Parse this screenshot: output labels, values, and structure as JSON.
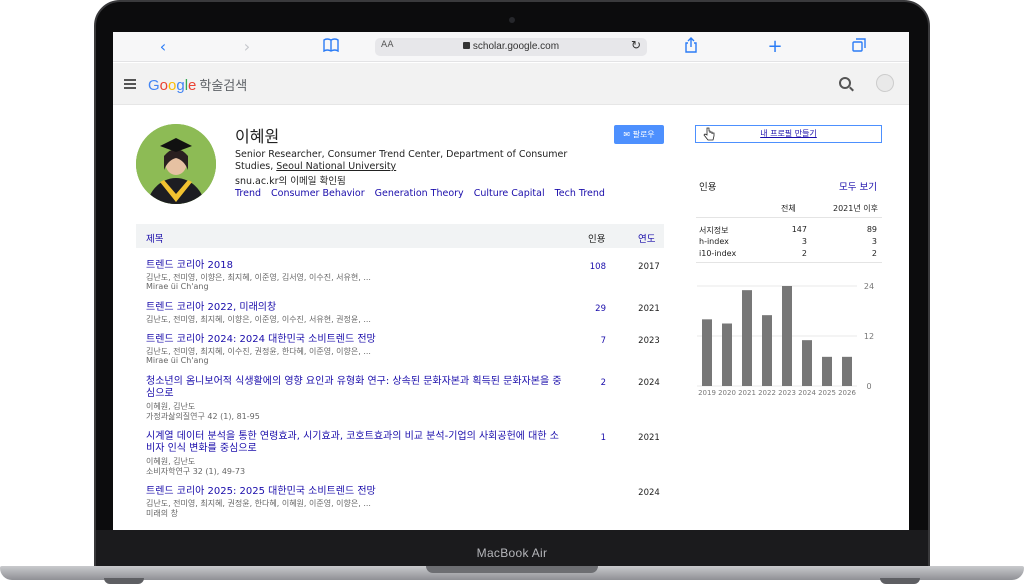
{
  "device": {
    "label": "MacBook Air"
  },
  "browser": {
    "address_prefix": "AA",
    "url": "scholar.google.com"
  },
  "header": {
    "logo_letters": [
      "G",
      "o",
      "o",
      "g",
      "l",
      "e"
    ],
    "logo_suffix": "학술검색"
  },
  "profile": {
    "name": "이혜원",
    "affiliation_prefix": "Senior Researcher, Consumer Trend Center, Department of Consumer Studies, ",
    "affiliation_link": "Seoul National University",
    "verified_email": "snu.ac.kr의 이메일 확인됨",
    "interests": [
      "Trend",
      "Consumer Behavior",
      "Generation Theory",
      "Culture Capital",
      "Tech Trend"
    ],
    "follow_label": "팔로우"
  },
  "table": {
    "col_title": "제목",
    "col_cited": "인용",
    "col_year": "연도",
    "rows": [
      {
        "title": "트렌드 코리아 2018",
        "authors": "김난도, 전미영, 이향은, 최지혜, 이준영, 김서영, 이수진, 서유현, ...",
        "venue": "Mirae üi Ch'ang",
        "cited": "108",
        "year": "2017"
      },
      {
        "title": "트렌드 코리아 2022, 미래의창",
        "authors": "김난도, 전미영, 최지혜, 이향은, 이준영, 이수진, 서유현, 권정윤, ...",
        "venue": "",
        "cited": "29",
        "year": "2021"
      },
      {
        "title": "트렌드 코리아 2024: 2024 대한민국 소비트렌드 전망",
        "authors": "김난도, 전미영, 최지혜, 이수진, 권정윤, 한다혜, 이준영, 이향은, ...",
        "venue": "Mirae üi Ch'ang",
        "cited": "7",
        "year": "2023"
      },
      {
        "title": "청소년의 옴니보어적 식생활에의 영향 요인과 유형화 연구: 상속된 문화자본과 획득된 문화자본을 중심으로",
        "authors": "이혜원, 김난도",
        "venue": "가정과삶의질연구 42 (1), 81-95",
        "cited": "2",
        "year": "2024"
      },
      {
        "title": "시계열 데이터 분석을 통한 연령효과, 시기효과, 코호트효과의 비교 분석-기업의 사회공헌에 대한 소비자 인식 변화를 중심으로",
        "authors": "이혜원, 김난도",
        "venue": "소비자학연구 32 (1), 49-73",
        "cited": "1",
        "year": "2021"
      },
      {
        "title": "트렌드 코리아 2025: 2025 대한민국 소비트렌드 전망",
        "authors": "김난도, 전미영, 최지혜, 권정윤, 한다혜, 이혜원, 이준영, 이향은, ...",
        "venue": "미래의 창",
        "cited": "",
        "year": "2024"
      }
    ]
  },
  "sidebar": {
    "make_profile_label": "내 프로필 만들기",
    "citations_title": "인용",
    "see_all": "모두 보기",
    "col_all": "전체",
    "col_since": "2021년 이후",
    "stats": [
      {
        "label": "서지정보",
        "all": "147",
        "since": "89"
      },
      {
        "label": "h-index",
        "all": "3",
        "since": "3"
      },
      {
        "label": "i10-index",
        "all": "2",
        "since": "2"
      }
    ]
  },
  "chart_data": {
    "type": "bar",
    "categories": [
      "2019",
      "2020",
      "2021",
      "2022",
      "2023",
      "2024",
      "2025",
      "2026"
    ],
    "values": [
      16,
      15,
      23,
      17,
      24,
      11,
      7,
      7
    ],
    "ylim": [
      0,
      24
    ],
    "yticks": [
      "24",
      "12",
      "0"
    ],
    "bar_color": "#777777",
    "grid": true
  },
  "colors": {
    "link": "#1a0dab",
    "button": "#4d90fe"
  }
}
